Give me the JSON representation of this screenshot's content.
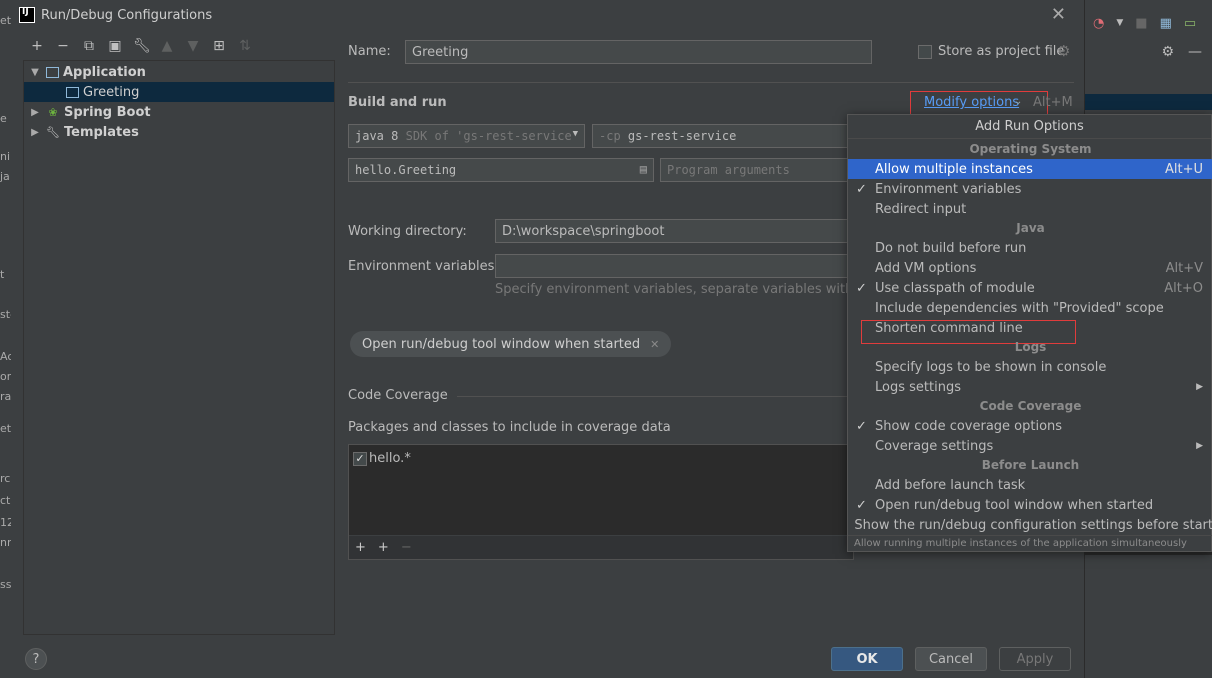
{
  "dialog": {
    "title": "Run/Debug Configurations"
  },
  "tree": {
    "application": "Application",
    "greeting": "Greeting",
    "spring_boot": "Spring Boot",
    "templates": "Templates"
  },
  "form": {
    "name_label": "Name:",
    "name_value": "Greeting",
    "store_label": "Store as project file",
    "build_run_title": "Build and run",
    "modify_options": "Modify options",
    "modify_shortcut": "Alt+M",
    "sdk_value": "java 8",
    "sdk_detail": "SDK of 'gs-rest-service",
    "cp_prefix": "-cp",
    "cp_value": "gs-rest-service",
    "main_class": "hello.Greeting",
    "program_args_placeholder": "Program arguments",
    "working_dir_label": "Working directory:",
    "working_dir_value": "D:\\workspace\\springboot",
    "env_vars_label": "Environment variables:",
    "env_vars_hint": "Specify environment variables, separate variables with semic",
    "chip_label": "Open run/debug tool window when started",
    "code_coverage_title": "Code Coverage",
    "packages_label": "Packages and classes to include in coverage data",
    "coverage_entry": "hello.*"
  },
  "buttons": {
    "ok": "OK",
    "cancel": "Cancel",
    "apply": "Apply",
    "help": "?"
  },
  "popup": {
    "title": "Add Run Options",
    "groups": {
      "os": "Operating System",
      "java": "Java",
      "logs": "Logs",
      "coverage": "Code Coverage",
      "before": "Before Launch"
    },
    "items": {
      "allow_multiple": "Allow multiple instances",
      "allow_multiple_sc": "Alt+U",
      "env_vars": "Environment variables",
      "redirect_input": "Redirect input",
      "no_build": "Do not build before run",
      "vm_options": "Add VM options",
      "vm_options_sc": "Alt+V",
      "classpath": "Use classpath of module",
      "classpath_sc": "Alt+O",
      "provided": "Include dependencies with \"Provided\" scope",
      "shorten": "Shorten command line",
      "logs_console": "Specify logs to be shown in console",
      "logs_settings": "Logs settings",
      "show_coverage": "Show code coverage options",
      "coverage_settings": "Coverage settings",
      "before_task": "Add before launch task",
      "open_tool_window": "Open run/debug tool window when started",
      "show_settings": "Show the run/debug configuration settings before start"
    },
    "footer": "Allow running multiple instances of the application simultaneously"
  },
  "colors": {
    "accent": "#589df6",
    "highlight": "#2f65ca",
    "ok_button": "#365880",
    "annotation": "#e03c3c"
  }
}
